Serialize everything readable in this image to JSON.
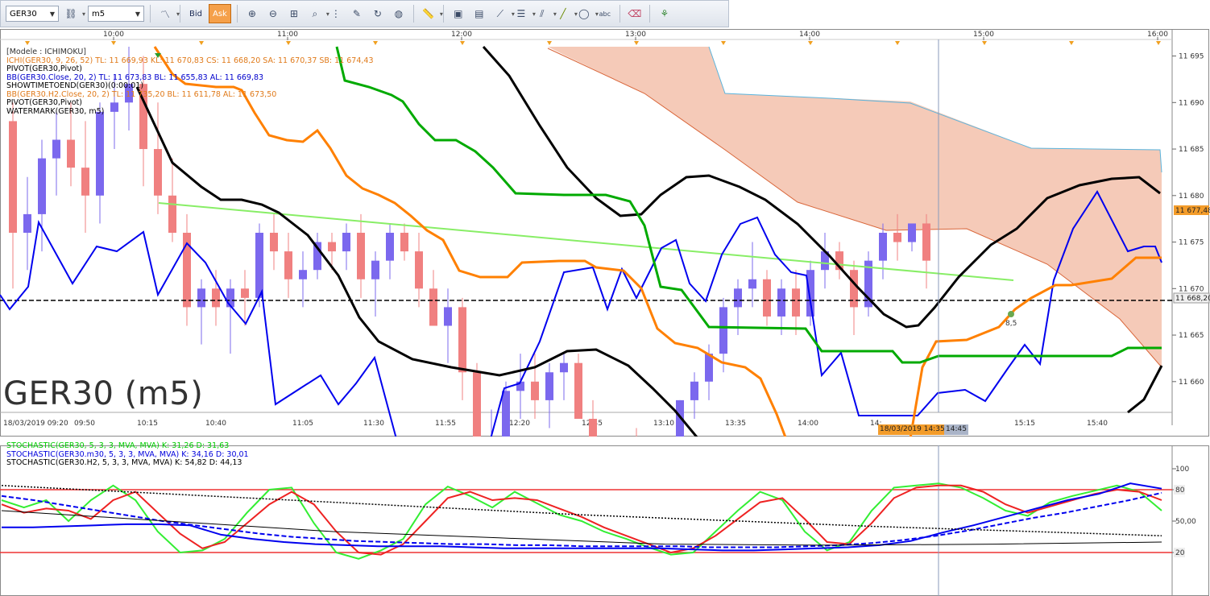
{
  "toolbar": {
    "symbol": "GER30",
    "timeframe": "m5",
    "bid_label": "Bid",
    "ask_label": "Ask",
    "tools": [
      "line-chart-icon",
      "magnifier-plus-icon",
      "magnifier-minus-icon",
      "zoom-window-icon",
      "zoom-fit-icon",
      "vertical-lines-icon",
      "comment-icon",
      "refresh-icon",
      "globe-icon",
      "ruler-icon",
      "image-icon",
      "layout-icon",
      "drawing-tools-icon",
      "horizontal-lines-icon",
      "trend-tools-icon",
      "line-tool-icon",
      "ellipse-icon",
      "abc-text-icon",
      "eraser-icon",
      "hierarchy-icon"
    ]
  },
  "main_chart": {
    "watermark": "GER30 (m5)",
    "top_time_labels": [
      "10:00",
      "11:00",
      "12:00",
      "13:00",
      "14:00",
      "15:00",
      "16:00"
    ],
    "bottom_time_labels": [
      "18/03/2019 09:20",
      "09:50",
      "10:15",
      "10:40",
      "11:05",
      "11:30",
      "11:55",
      "12:20",
      "12:45",
      "13:10",
      "13:35",
      "14:00",
      "14:",
      "15:15",
      "15:40"
    ],
    "crosshair_time_label": "18/03/2019 14:35",
    "crosshair_time_label_2": "14:45",
    "price_ticks": [
      "11 695",
      "11 690",
      "11 685",
      "11 680",
      "11 675",
      "11 670",
      "11 665",
      "11 660"
    ],
    "price_marker_1": "11 677,48",
    "price_marker_2": "11 668,20",
    "annotation": "8,5",
    "legend": [
      {
        "text": "[Modele : ICHIMOKU]",
        "color": "#333333"
      },
      {
        "text": "ICHI(GER30, 9, 26, 52)  TL: 11 669,93  KL: 11 670,83  CS: 11 668,20  SA: 11 670,37  SB: 11 674,43",
        "color": "#e07a1a"
      },
      {
        "text": "PIVOT(GER30,Pivot)",
        "color": "#000000"
      },
      {
        "text": "BB(GER30.Close, 20, 2)  TL: 11 673,83  BL: 11 655,83  AL: 11 669,83",
        "color": "#0000cc"
      },
      {
        "text": "SHOWTIMETOEND(GER30)(0:00:01)",
        "color": "#000000"
      },
      {
        "text": "BB(GER30.H2.Close, 20, 2)  TL: 11 735,20  BL: 11 611,78  AL: 11 673,50",
        "color": "#e07a1a"
      },
      {
        "text": "PIVOT(GER30,Pivot)",
        "color": "#000000"
      },
      {
        "text": "WATERMARK(GER30, m5)",
        "color": "#000000"
      }
    ],
    "colors": {
      "bull_candle": "#7b68ee",
      "bear_candle": "#f08080",
      "cloud": "#f2b8a0",
      "tenkan": "#ff8000",
      "kijun": "#00aa00",
      "bb_blue": "#0000ee",
      "bb_black": "#000000",
      "trend_line": "#88ee66"
    }
  },
  "chart_data": [
    {
      "type": "candlestick",
      "title": "GER30 (m5)",
      "ylim": [
        11655,
        11696
      ],
      "ohlc": [
        [
          11688,
          11690,
          11670,
          11676
        ],
        [
          11676,
          11682,
          11672,
          11678
        ],
        [
          11678,
          11686,
          11674,
          11684
        ],
        [
          11684,
          11689,
          11680,
          11686
        ],
        [
          11686,
          11690,
          11681,
          11683
        ],
        [
          11683,
          11688,
          11676,
          11680
        ],
        [
          11680,
          11690,
          11677,
          11689
        ],
        [
          11689,
          11693,
          11685,
          11690
        ],
        [
          11690,
          11696,
          11687,
          11692
        ],
        [
          11692,
          11695,
          11681,
          11685
        ],
        [
          11685,
          11690,
          11678,
          11680
        ],
        [
          11680,
          11684,
          11675,
          11676
        ],
        [
          11676,
          11678,
          11666,
          11668
        ],
        [
          11668,
          11671,
          11664,
          11670
        ],
        [
          11670,
          11672,
          11666,
          11668
        ],
        [
          11668,
          11671,
          11663,
          11670
        ],
        [
          11670,
          11672,
          11666,
          11669
        ],
        [
          11669,
          11677,
          11668,
          11676
        ],
        [
          11676,
          11678,
          11672,
          11674
        ],
        [
          11674,
          11676,
          11669,
          11671
        ],
        [
          11671,
          11674,
          11668,
          11672
        ],
        [
          11672,
          11676,
          11671,
          11675
        ],
        [
          11675,
          11676,
          11672,
          11674
        ],
        [
          11674,
          11677,
          11672,
          11676
        ],
        [
          11676,
          11678,
          11669,
          11671
        ],
        [
          11671,
          11674,
          11667,
          11673
        ],
        [
          11673,
          11677,
          11671,
          11676
        ],
        [
          11676,
          11677,
          11673,
          11674
        ],
        [
          11674,
          11676,
          11668,
          11670
        ],
        [
          11670,
          11672,
          11666,
          11666
        ],
        [
          11666,
          11670,
          11662,
          11668
        ],
        [
          11668,
          11669,
          11658,
          11661
        ],
        [
          11661,
          11662,
          11652,
          11652
        ],
        [
          11652,
          11657,
          11650,
          11654
        ],
        [
          11654,
          11660,
          11653,
          11659
        ],
        [
          11659,
          11663,
          11656,
          11660
        ],
        [
          11660,
          11663,
          11656,
          11658
        ],
        [
          11658,
          11662,
          11655,
          11661
        ],
        [
          11661,
          11663,
          11658,
          11662
        ],
        [
          11662,
          11663,
          11656,
          11656
        ],
        [
          11656,
          11658,
          11650,
          11651
        ],
        [
          11651,
          11653,
          11648,
          11650
        ],
        [
          11650,
          11653,
          11648,
          11652
        ],
        [
          11652,
          11655,
          11649,
          11650
        ],
        [
          11650,
          11653,
          11647,
          11648
        ],
        [
          11648,
          11651,
          11645,
          11650
        ],
        [
          11650,
          11658,
          11648,
          11658
        ],
        [
          11658,
          11661,
          11656,
          11660
        ],
        [
          11660,
          11664,
          11658,
          11663
        ],
        [
          11663,
          11669,
          11661,
          11668
        ],
        [
          11668,
          11671,
          11665,
          11670
        ],
        [
          11670,
          11675,
          11668,
          11671
        ],
        [
          11671,
          11672,
          11666,
          11667
        ],
        [
          11667,
          11671,
          11665,
          11670
        ],
        [
          11670,
          11672,
          11665,
          11667
        ],
        [
          11667,
          11673,
          11666,
          11672
        ],
        [
          11672,
          11676,
          11670,
          11674
        ],
        [
          11674,
          11675,
          11671,
          11672
        ],
        [
          11672,
          11673,
          11665,
          11668
        ],
        [
          11668,
          11674,
          11667,
          11673
        ],
        [
          11673,
          11677,
          11671,
          11676
        ],
        [
          11676,
          11678,
          11673,
          11675
        ],
        [
          11675,
          11677,
          11674,
          11677
        ],
        [
          11677,
          11678,
          11670,
          11673
        ]
      ]
    },
    {
      "type": "line",
      "title": "Stochastic",
      "ylim": [
        0,
        100
      ],
      "y_ticks": [
        100,
        80,
        "50,00",
        20
      ],
      "legend": [
        {
          "name": "STOCHASTIC(GER30, 5, 3, 3, MVA, MVA)  K: 31,26  D: 31,63",
          "color": "#00cc00"
        },
        {
          "name": "STOCHASTIC(GER30.m30, 5, 3, 3, MVA, MVA)  K: 34,16  D: 30,01",
          "color": "#0000dd"
        },
        {
          "name": "STOCHASTIC(GER30.H2, 5, 3, 3, MVA, MVA)  K: 54,82  D: 44,13",
          "color": "#000000"
        }
      ],
      "series": [
        {
          "name": "K",
          "color": "#33ee33",
          "values": [
            70,
            63,
            70,
            50,
            70,
            84,
            70,
            40,
            20,
            22,
            33,
            58,
            80,
            82,
            48,
            20,
            14,
            22,
            33,
            66,
            83,
            74,
            63,
            78,
            67,
            56,
            50,
            40,
            33,
            25,
            18,
            20,
            40,
            60,
            78,
            70,
            40,
            22,
            30,
            60,
            82,
            84,
            86,
            82,
            72,
            60,
            55,
            68,
            74,
            79,
            84,
            78,
            60
          ]
        },
        {
          "name": "D",
          "color": "#ee2222",
          "values": [
            66,
            58,
            62,
            60,
            52,
            70,
            78,
            58,
            38,
            24,
            30,
            48,
            66,
            78,
            66,
            40,
            20,
            18,
            28,
            50,
            72,
            78,
            70,
            72,
            70,
            62,
            54,
            44,
            36,
            28,
            20,
            24,
            36,
            52,
            68,
            72,
            52,
            30,
            28,
            48,
            72,
            82,
            84,
            84,
            78,
            66,
            58,
            64,
            70,
            76,
            80,
            78,
            70
          ]
        },
        {
          "name": "K m30",
          "color": "#0000ee",
          "values": [
            44,
            44,
            45,
            46,
            47,
            47,
            46,
            37,
            33,
            30,
            28,
            27,
            26,
            26,
            26,
            25,
            24,
            24,
            24,
            24,
            24,
            24,
            23,
            22,
            22,
            23,
            24,
            25,
            27,
            31,
            39,
            46,
            54,
            62,
            70,
            76,
            86,
            81
          ]
        },
        {
          "name": "D m30",
          "color": "#0000ee",
          "values": [
            74,
            70,
            65,
            60,
            55,
            50,
            46,
            42,
            38,
            35,
            33,
            31,
            30,
            29,
            28,
            28,
            27,
            27,
            26,
            26,
            26,
            26,
            25,
            25,
            25,
            26,
            27,
            29,
            32,
            36,
            41,
            47,
            53,
            58,
            64,
            70,
            77
          ]
        },
        {
          "name": "K H2",
          "color": "#000000",
          "values": [
            60,
            50,
            40,
            34,
            28,
            27,
            28,
            30
          ]
        },
        {
          "name": "D H2",
          "color": "#000000",
          "values": [
            84,
            70,
            56,
            45,
            36
          ]
        }
      ]
    }
  ]
}
